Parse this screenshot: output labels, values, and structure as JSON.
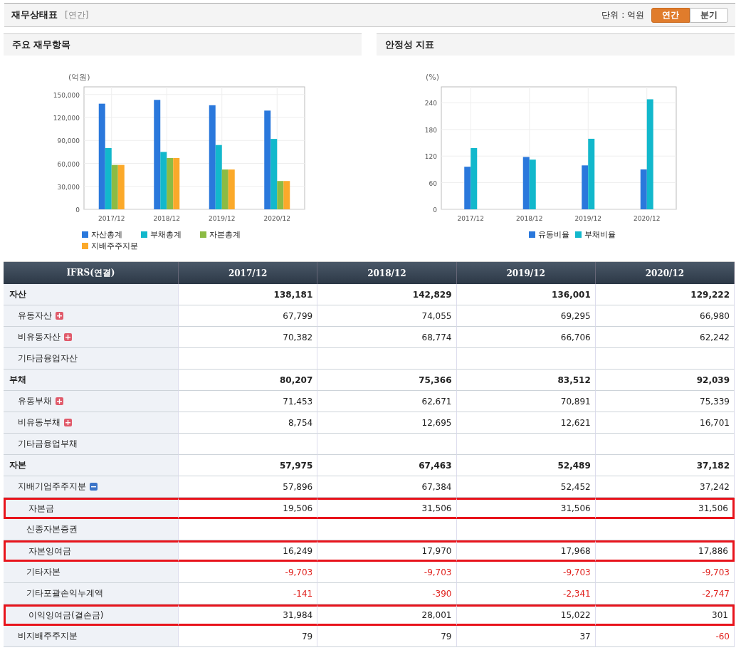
{
  "header": {
    "title": "재무상태표",
    "period_tag": "[연간]",
    "unit": "단위 : 억원",
    "tabs": [
      {
        "label": "연간",
        "selected": true
      },
      {
        "label": "분기",
        "selected": false
      }
    ]
  },
  "panels": [
    {
      "title": "주요 재무항목",
      "unit": "(억원)",
      "chart_data": {
        "type": "bar",
        "categories": [
          "2017/12",
          "2018/12",
          "2019/12",
          "2020/12"
        ],
        "grid": true,
        "ylim": [
          0,
          160000
        ],
        "yticks": [
          {
            "value": 0,
            "label": "0"
          },
          {
            "value": 30000,
            "label": "30,000"
          },
          {
            "value": 60000,
            "label": "60,000"
          },
          {
            "value": 90000,
            "label": "90,000"
          },
          {
            "value": 120000,
            "label": "120,000"
          },
          {
            "value": 150000,
            "label": "150,000"
          }
        ],
        "series": [
          {
            "name": "자산총계",
            "color": "#2a78dc",
            "values": [
              138000,
              143000,
              136000,
              129000
            ]
          },
          {
            "name": "부채총계",
            "color": "#12b8cc",
            "values": [
              80000,
              75000,
              84000,
              92000
            ]
          },
          {
            "name": "자본총계",
            "color": "#8cbb44",
            "values": [
              58000,
              67000,
              52000,
              37000
            ]
          },
          {
            "name": "지배주주지분",
            "color": "#fba92a",
            "values": [
              58000,
              67000,
              52000,
              37000
            ]
          }
        ]
      }
    },
    {
      "title": "안정성 지표",
      "unit": "(%)",
      "chart_data": {
        "type": "bar",
        "categories": [
          "2017/12",
          "2018/12",
          "2019/12",
          "2020/12"
        ],
        "grid": true,
        "ylim": [
          0,
          276
        ],
        "yticks": [
          0,
          60,
          120,
          180,
          240
        ],
        "series": [
          {
            "name": "유동비율",
            "color": "#2a78dc",
            "values": [
              96,
              118,
              99,
              90
            ]
          },
          {
            "name": "부채비율",
            "color": "#12b8cc",
            "values": [
              138,
              112,
              159,
              248
            ]
          }
        ]
      }
    }
  ],
  "table": {
    "columns": [
      "IFRS(연결)",
      "2017/12",
      "2018/12",
      "2019/12",
      "2020/12"
    ],
    "rows": [
      {
        "label": "자산",
        "kind": "total",
        "values": [
          "138,181",
          "142,829",
          "136,001",
          "129,222"
        ],
        "children": [
          {
            "label": "유동자산",
            "kind": "item",
            "expanded": false,
            "values": [
              "67,799",
              "74,055",
              "69,295",
              "66,980"
            ]
          },
          {
            "label": "비유동자산",
            "kind": "item",
            "expanded": false,
            "values": [
              "70,382",
              "68,774",
              "66,706",
              "62,242"
            ]
          },
          {
            "label": "기타금융업자산",
            "kind": "item"
          }
        ]
      },
      {
        "label": "부채",
        "kind": "total",
        "values": [
          "80,207",
          "75,366",
          "83,512",
          "92,039"
        ],
        "children": [
          {
            "label": "유동부채",
            "kind": "item",
            "expanded": false,
            "values": [
              "71,453",
              "62,671",
              "70,891",
              "75,339"
            ]
          },
          {
            "label": "비유동부채",
            "kind": "item",
            "expanded": false,
            "values": [
              "8,754",
              "12,695",
              "12,621",
              "16,701"
            ]
          },
          {
            "label": "기타금융업부채",
            "kind": "item"
          }
        ]
      },
      {
        "label": "자본",
        "kind": "total",
        "values": [
          "57,975",
          "67,463",
          "52,489",
          "37,182"
        ],
        "children": [
          {
            "label": "지배기업주주지분",
            "kind": "item",
            "expanded": true,
            "values": [
              "57,896",
              "67,384",
              "52,452",
              "37,242"
            ],
            "children": [
              {
                "label": "자본금",
                "kind": "item",
                "highlighted": true,
                "values": [
                  "19,506",
                  "31,506",
                  "31,506",
                  "31,506"
                ]
              },
              {
                "label": "신종자본증권",
                "kind": "item",
                "highlighted": false
              },
              {
                "label": "자본잉여금",
                "kind": "item",
                "highlighted": true,
                "values": [
                  "16,249",
                  "17,970",
                  "17,968",
                  "17,886"
                ]
              },
              {
                "label": "기타자본",
                "kind": "item",
                "highlighted": false,
                "values": [
                  "-9,703",
                  "-9,703",
                  "-9,703",
                  "-9,703"
                ]
              },
              {
                "label": "기타포괄손익누계액",
                "kind": "item",
                "highlighted": false,
                "values": [
                  "-141",
                  "-390",
                  "-2,341",
                  "-2,747"
                ]
              },
              {
                "label": "이익잉여금(결손금)",
                "kind": "item",
                "highlighted": true,
                "values": [
                  "31,984",
                  "28,001",
                  "15,022",
                  "301"
                ]
              }
            ]
          },
          {
            "label": "비지배주주지분",
            "kind": "item",
            "values": [
              "79",
              "79",
              "37",
              "-60"
            ]
          }
        ]
      }
    ]
  }
}
